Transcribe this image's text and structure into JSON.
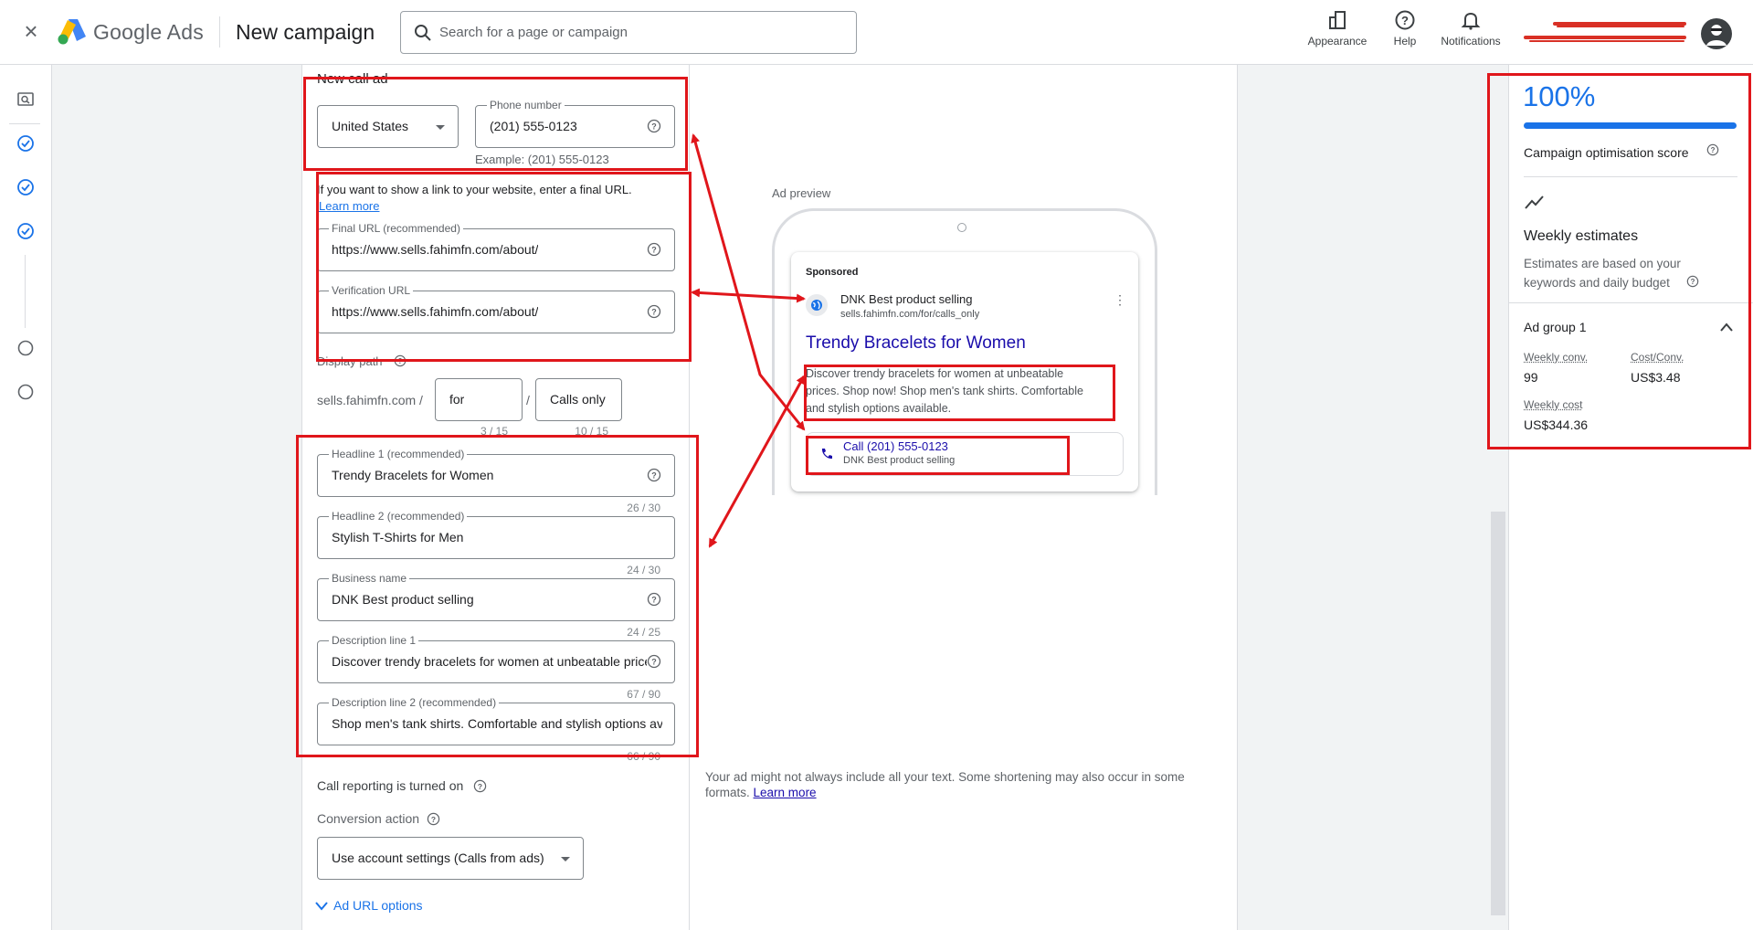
{
  "header": {
    "close_label": "×",
    "product_name": "Google Ads",
    "page_title": "New campaign",
    "search_placeholder": "Search for a page or campaign",
    "appearance_label": "Appearance",
    "help_label": "Help",
    "notifications_label": "Notifications"
  },
  "form": {
    "section_title": "New call ad",
    "country": "United States",
    "phone_label": "Phone number",
    "phone_value": "(201) 555-0123",
    "phone_example": "Example: (201) 555-0123",
    "final_url_prompt": "If you want to show a link to your website, enter a final URL.",
    "learn_more": "Learn more",
    "final_url_label": "Final URL (recommended)",
    "final_url_value": "https://www.sells.fahimfn.com/about/",
    "verification_url_label": "Verification URL",
    "verification_url_value": "https://www.sells.fahimfn.com/about/",
    "display_path_label": "Display path",
    "display_domain": "sells.fahimfn.com /",
    "path_sep": "/",
    "path1": "for",
    "path1_count": "3 / 15",
    "path2": "Calls only",
    "path2_count": "10 / 15",
    "headline1_label": "Headline 1 (recommended)",
    "headline1_value": "Trendy Bracelets for Women",
    "headline1_count": "26 / 30",
    "headline2_label": "Headline 2 (recommended)",
    "headline2_value": "Stylish T-Shirts for Men",
    "headline2_count": "24 / 30",
    "business_label": "Business name",
    "business_value": "DNK Best product selling",
    "business_count": "24 / 25",
    "desc1_label": "Description line 1",
    "desc1_value": "Discover trendy bracelets for women at unbeatable prices. Shop now!",
    "desc1_count": "67 / 90",
    "desc2_label": "Description line 2 (recommended)",
    "desc2_value": "Shop men's tank shirts. Comfortable and stylish options available.",
    "desc2_count": "66 / 90",
    "call_reporting": "Call reporting is turned on",
    "conversion_label": "Conversion action",
    "conversion_value": "Use account settings (Calls from ads)",
    "ad_url_options": "Ad URL options"
  },
  "preview": {
    "label": "Ad preview",
    "sponsored": "Sponsored",
    "business": "DNK Best product selling",
    "display_url": "sells.fahimfn.com/for/calls_only",
    "headline": "Trendy Bracelets for Women",
    "description_line1": "Discover trendy bracelets for women at unbeatable",
    "description_line2": "prices. Shop now! Shop men's tank shirts. Comfortable",
    "description_line3": "and stylish options available.",
    "call_text": "Call (201) 555-0123",
    "call_sub": "DNK Best product selling",
    "note": "Your ad might not always include all your text. Some shortening may also occur in some",
    "note_line2": "formats.",
    "note_link": "Learn more"
  },
  "right_panel": {
    "score": "100%",
    "score_fraction": 1.0,
    "score_label": "Campaign optimisation score",
    "weekly_title": "Weekly estimates",
    "weekly_desc_line1": "Estimates are based on your",
    "weekly_desc_line2": "keywords and daily budget",
    "ad_group": "Ad group 1",
    "weekly_conv_label": "Weekly conv.",
    "weekly_conv_value": "99",
    "cost_conv_label": "Cost/Conv.",
    "cost_conv_value": "US$3.48",
    "weekly_cost_label": "Weekly cost",
    "weekly_cost_value": "US$344.36"
  },
  "colors": {
    "accent": "#1a73e8",
    "annotation": "#e0161b"
  }
}
